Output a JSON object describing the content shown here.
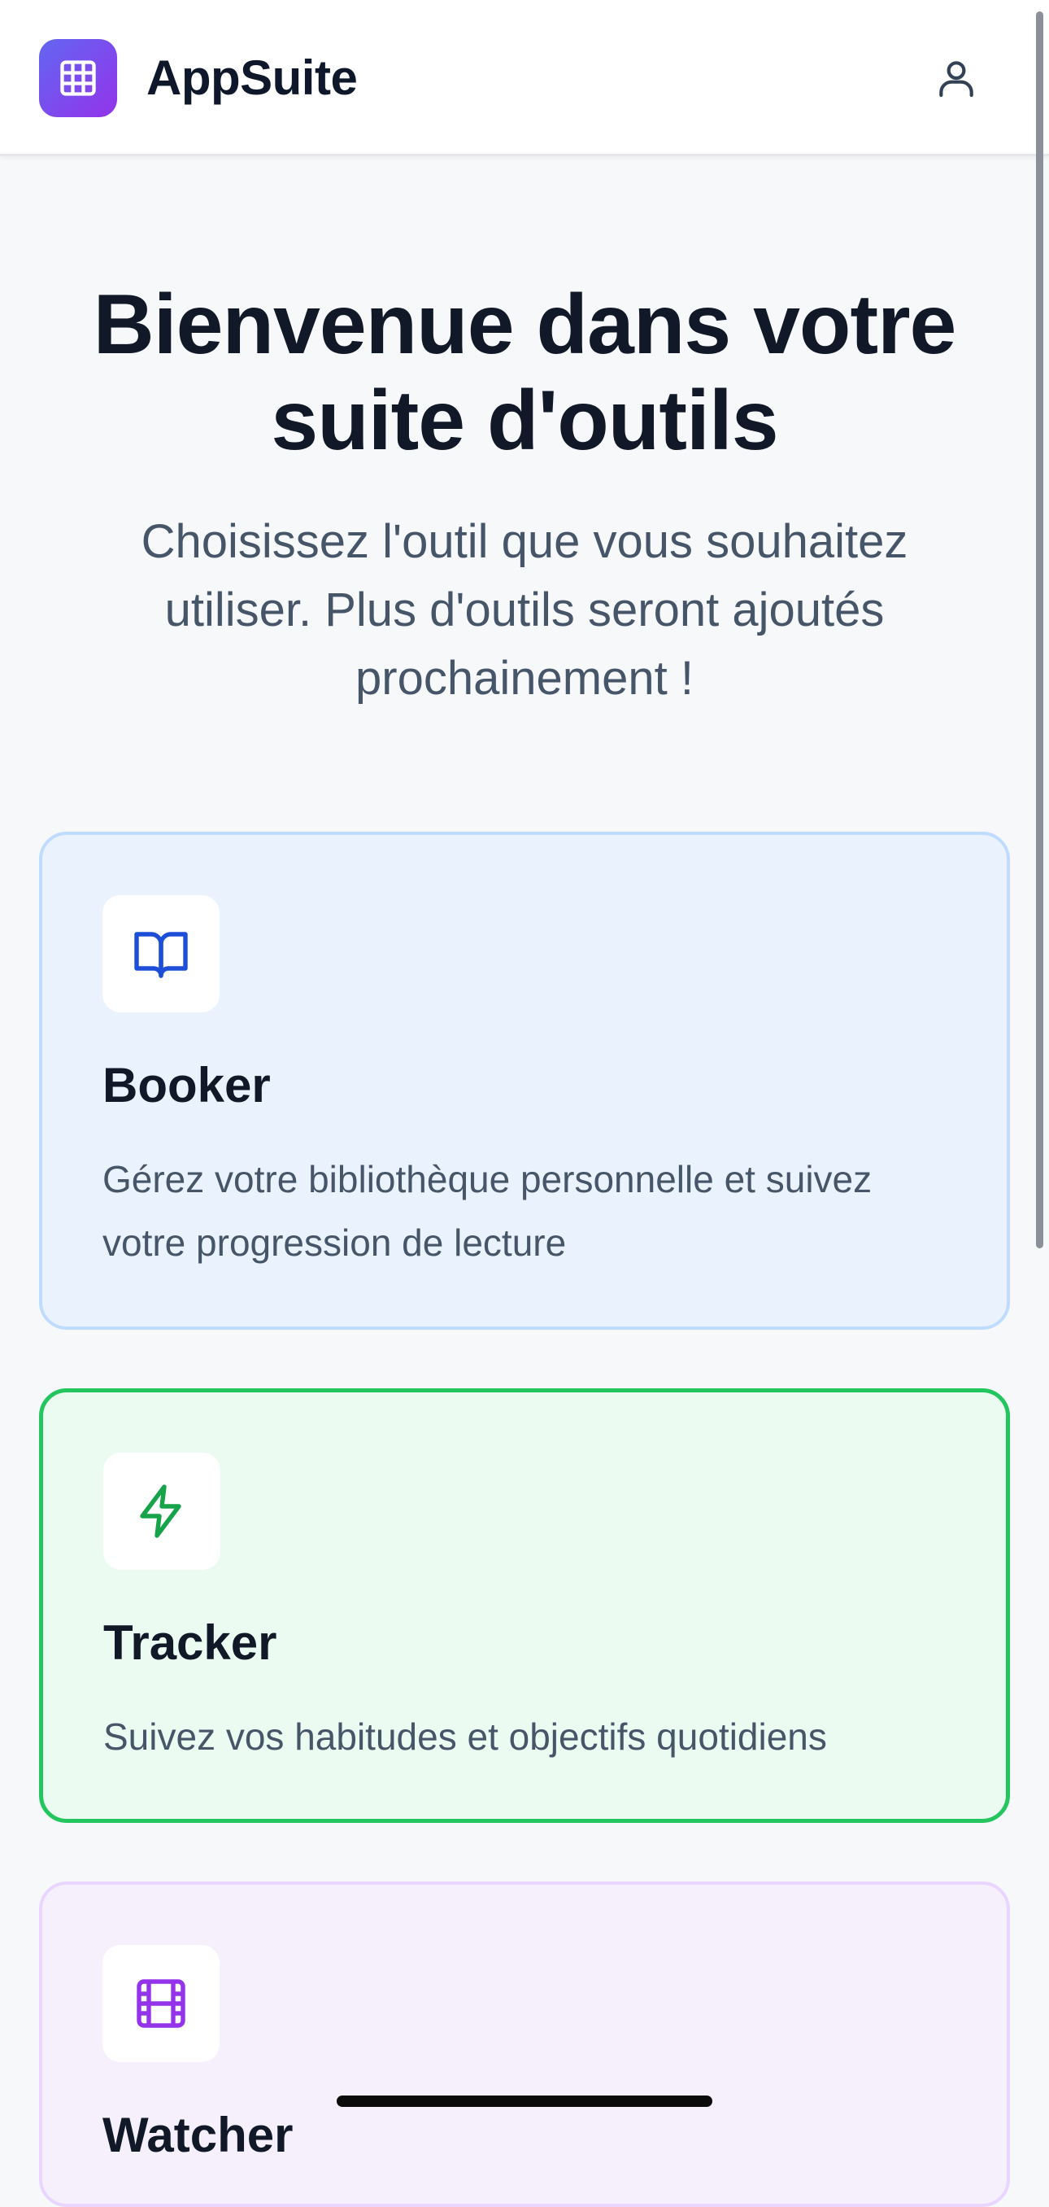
{
  "header": {
    "app_name": "AppSuite",
    "logo_icon": "grid-icon",
    "profile_icon": "user-icon"
  },
  "hero": {
    "title": "Bienvenue dans votre suite d'outils",
    "subtitle": "Choisissez l'outil que vous souhaitez utiliser. Plus d'outils seront ajoutés prochainement !"
  },
  "tools": [
    {
      "name": "Booker",
      "description": "Gérez votre bibliothèque personnelle et suivez votre progression de lecture",
      "icon": "book-open-icon",
      "accent": "#1d4ed8"
    },
    {
      "name": "Tracker",
      "description": "Suivez vos habitudes et objectifs quotidiens",
      "icon": "lightning-icon",
      "accent": "#16a34a"
    },
    {
      "name": "Watcher",
      "description": "",
      "icon": "film-icon",
      "accent": "#9333ea"
    }
  ],
  "colors": {
    "brand_gradient_start": "#6366f1",
    "brand_gradient_end": "#9333ea",
    "booker_bg": "#eaf3fd",
    "tracker_bg": "#ecfbf1",
    "tracker_border": "#22c55e",
    "watcher_bg": "#f5f0fb"
  }
}
